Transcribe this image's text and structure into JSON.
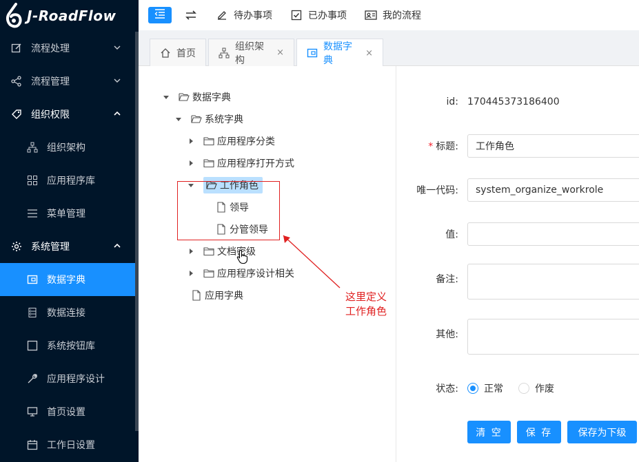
{
  "app": {
    "title": "J-RoadFlow"
  },
  "sidebar": {
    "items": [
      {
        "label": "流程处理",
        "icon": "edit-icon"
      },
      {
        "label": "流程管理",
        "icon": "share-icon"
      },
      {
        "label": "组织权限",
        "icon": "tag-icon"
      },
      {
        "label": "组织架构",
        "icon": "org-icon"
      },
      {
        "label": "应用程序库",
        "icon": "grid-icon"
      },
      {
        "label": "菜单管理",
        "icon": "list-icon"
      },
      {
        "label": "系统管理",
        "icon": "gear-icon"
      },
      {
        "label": "数据字典",
        "icon": "dictionary-icon"
      },
      {
        "label": "数据连接",
        "icon": "database-icon"
      },
      {
        "label": "系统按钮库",
        "icon": "square-icon"
      },
      {
        "label": "应用程序设计",
        "icon": "wrench-icon"
      },
      {
        "label": "首页设置",
        "icon": "monitor-icon"
      },
      {
        "label": "工作日设置",
        "icon": "calendar-icon"
      }
    ],
    "accent": "#1890ff",
    "background": "#001529"
  },
  "topbar": {
    "todo_label": "待办事项",
    "done_label": "已办事项",
    "myflow_label": "我的流程"
  },
  "tabs": [
    {
      "label": "首页"
    },
    {
      "label": "组织架构",
      "close": "×"
    },
    {
      "label": "数据字典",
      "close": "×"
    }
  ],
  "tree": {
    "root": "数据字典",
    "system": "系统字典",
    "app_category": "应用程序分类",
    "app_open_mode": "应用程序打开方式",
    "work_role": "工作角色",
    "leader": "领导",
    "division_leader": "分管领导",
    "doc_level": "文档密级",
    "app_design": "应用程序设计相关",
    "app_dict": "应用字典"
  },
  "annotation": "这里定义工作角色",
  "form": {
    "id_label": "id:",
    "id_value": "170445373186400",
    "title_label": "标题:",
    "title_required": "*",
    "title_value": "工作角色",
    "code_label": "唯一代码:",
    "code_value": "system_organize_workrole",
    "value_label": "值:",
    "note_label": "备注:",
    "other_label": "其他:",
    "status_label": "状态:",
    "status_normal": "正常",
    "status_void": "作废",
    "status_selected": "正常",
    "clear_button": "清 空",
    "save_button": "保 存",
    "save_child_button": "保存为下级"
  }
}
